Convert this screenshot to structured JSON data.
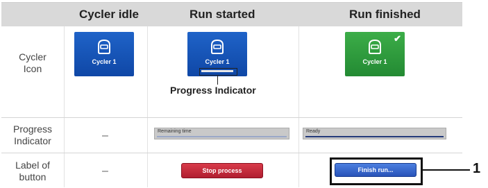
{
  "header": {
    "col1": "Cycler idle",
    "col2": "Run started",
    "col3": "Run finished"
  },
  "rows": {
    "icon_label": [
      "Cycler",
      "Icon"
    ],
    "progress_label": [
      "Progress",
      "Indicator"
    ],
    "button_label": [
      "Label of",
      "button"
    ]
  },
  "icons": {
    "idle_name": "Cycler 1",
    "started_name": "Cycler 1",
    "finished_name": "Cycler 1",
    "idle_color": "#1f63c8",
    "finished_color": "#3cad48",
    "glyph": "cycler-icon",
    "check": "check-icon"
  },
  "callout": {
    "text": "Progress Indicator"
  },
  "progress": {
    "idle": "–",
    "started_text": "Remaining time",
    "finished_text": "Ready",
    "finished_fraction": 1.0
  },
  "buttons": {
    "idle": "–",
    "stop": "Stop process",
    "finish": "Finish run..."
  },
  "marker": {
    "number": "1"
  }
}
